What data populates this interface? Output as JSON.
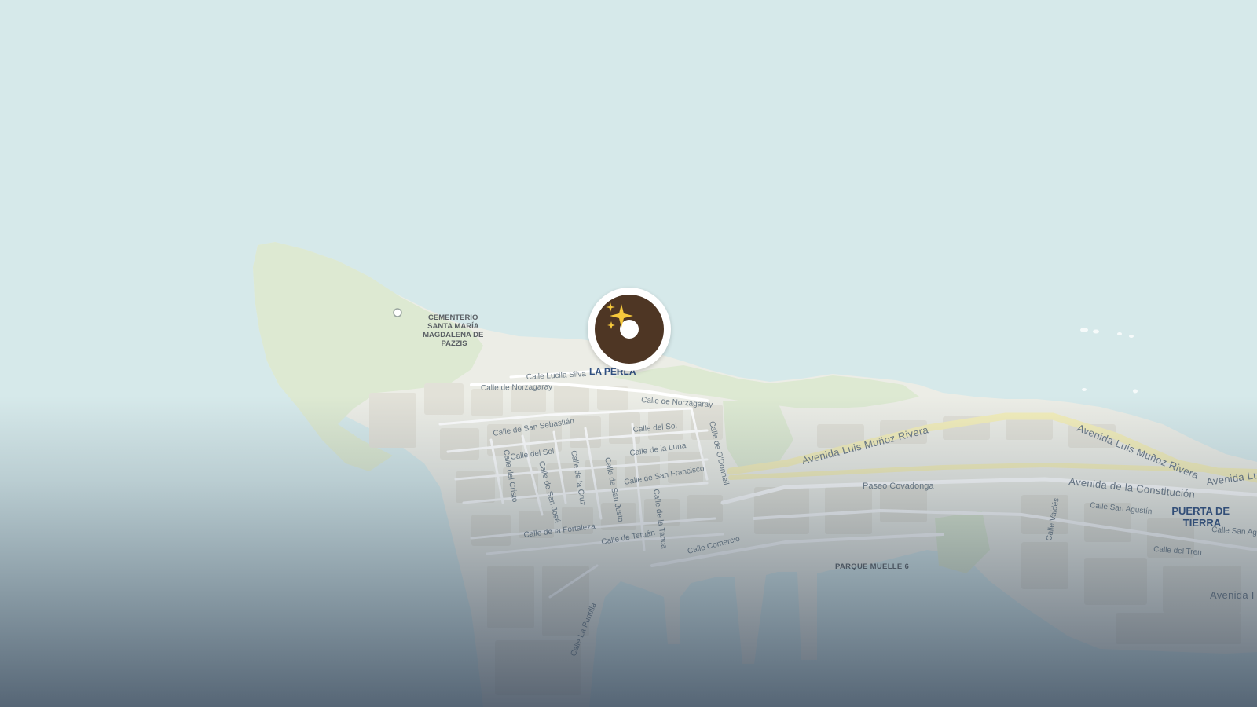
{
  "colors": {
    "water": "#d6e9ea",
    "land": "#ecede6",
    "park": "#dde9d2",
    "block": "#e3e2da",
    "road": "#ffffff",
    "highway": "#f3eebc",
    "marker_ring": "#ffffff",
    "marker_donut": "#4e3624",
    "label_district": "#2f4f80",
    "label_street": "#6b7a86"
  },
  "marker": {
    "icon": "donut-icon",
    "badge_icon": "sparkles-icon"
  },
  "labels": {
    "cemetery": [
      "CEMENTERIO",
      "SANTA MARÍA",
      "MAGDALENA DE",
      "PAZZIS"
    ],
    "district_la_perla": "LA PERLA",
    "district_puerta": [
      "PUERTA DE",
      "TIERRA"
    ],
    "park_muelle": "PARQUE MUELLE 6",
    "streets": {
      "lucila_silva": "Calle Lucila Silva",
      "norzagaray_w": "Calle de Norzagaray",
      "norzagaray_e": "Calle de Norzagaray",
      "san_sebastian": "Calle de San Sebastián",
      "sol_e": "Calle del Sol",
      "sol_w": "Calle del Sol",
      "luna": "Calle de la Luna",
      "san_francisco": "Calle de San Francisco",
      "odonnell": "Calle de O'Donnell",
      "cristo": "Calle del Cristo",
      "san_jose": "Calle de San José",
      "cruz": "Calle de la Cruz",
      "san_justo": "Calle de San Justo",
      "tanca": "Calle de la Tanca",
      "fortaleza": "Calle de la Fortaleza",
      "tetuan": "Calle de Tetuán",
      "comercio": "Calle Comercio",
      "puntilla": "Calle La Puntilla",
      "munoz_rivera_1": "Avenida Luis Muñoz Rivera",
      "munoz_rivera_2": "Avenida Luis Muñoz Rivera",
      "munoz_rivera_3": "Avenida Lu",
      "covadonga": "Paseo Covadonga",
      "constitucion": "Avenida de la Constitución",
      "san_agustin": "Calle San Agustín",
      "valdes": "Calle Valdés",
      "san_agus_cut": "Calle San Agu",
      "tren": "Calle del Tren",
      "avenida_cut": "Avenida I"
    }
  }
}
